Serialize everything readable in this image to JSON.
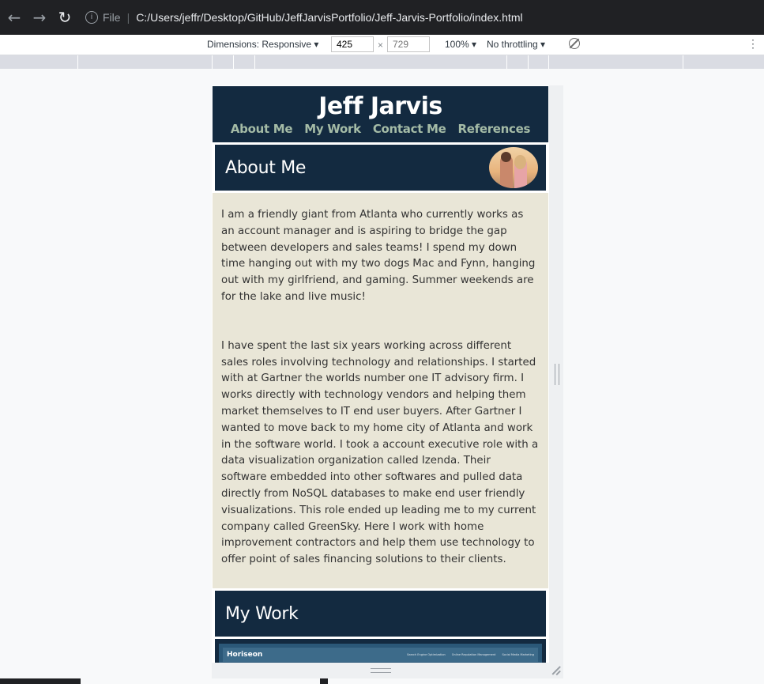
{
  "browser": {
    "file_label": "File",
    "url": "C:/Users/jeffr/Desktop/GitHub/JeffJarvisPortfolio/Jeff-Jarvis-Portfolio/index.html"
  },
  "devtools": {
    "dimensions_label": "Dimensions: Responsive",
    "width_value": "425",
    "height_placeholder": "729",
    "x_sep": "×",
    "zoom": "100%",
    "throttling": "No throttling"
  },
  "site": {
    "title": "Jeff Jarvis",
    "nav": [
      "About Me",
      "My Work",
      "Contact Me",
      "References"
    ]
  },
  "about": {
    "heading": "About Me",
    "paragraphs": [
      "I am a friendly giant from Atlanta who currently works as an account manager and is aspiring to bridge the gap between developers and sales teams! I spend my down time hanging out with my two dogs Mac and Fynn, hanging out with my girlfriend, and gaming. Summer weekends are for the lake and live music!",
      "I have spent the last six years working across different sales roles involving technology and relationships. I started with at Gartner the worlds number one IT advisory firm. I works directly with technology vendors and helping them market themselves to IT end user buyers. After Gartner I wanted to move back to my home city of Atlanta and work in the software world. I took a account executive role with a data visualization organization called Izenda. Their software embedded into other softwares and pulled data directly from NoSQL databases to make end user friendly visualizations. This role ended up leading me to my current company called GreenSky. Here I work with home improvement contractors and help them use technology to offer point of sales financing solutions to their clients."
    ]
  },
  "work": {
    "heading": "My Work",
    "preview": {
      "logo": "Horiseon",
      "nav": [
        "Search Engine Optimization",
        "Online Reputation Management",
        "Social Media Marketing"
      ]
    }
  }
}
